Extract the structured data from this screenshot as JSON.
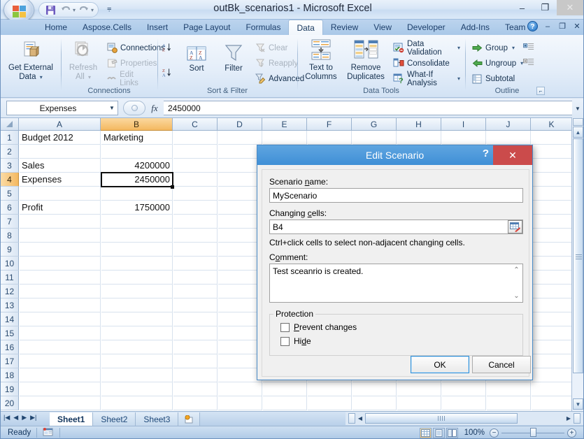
{
  "window": {
    "title": "outBk_scenarios1 - Microsoft Excel",
    "minimize": "–",
    "maximize": "❐",
    "close": "✕"
  },
  "quick_access": {
    "save_icon": "save-icon",
    "undo_icon": "undo-icon",
    "redo_icon": "redo-icon",
    "customize_icon": "customize-qat-icon"
  },
  "ribbon": {
    "tabs": [
      {
        "label": "Home",
        "active": false
      },
      {
        "label": "Aspose.Cells",
        "active": false
      },
      {
        "label": "Insert",
        "active": false
      },
      {
        "label": "Page Layout",
        "active": false
      },
      {
        "label": "Formulas",
        "active": false
      },
      {
        "label": "Data",
        "active": true
      },
      {
        "label": "Review",
        "active": false
      },
      {
        "label": "View",
        "active": false
      },
      {
        "label": "Developer",
        "active": false
      },
      {
        "label": "Add-Ins",
        "active": false
      },
      {
        "label": "Team",
        "active": false
      }
    ],
    "help_icon": "help-icon",
    "ribbon_minimize": "–",
    "ribbon_restore": "❐",
    "ribbon_close": "✕",
    "groups": [
      {
        "name": "Get External Data",
        "label": "",
        "items": [
          {
            "label": "Get External\nData",
            "line1": "Get External",
            "line2": "Data",
            "dropdown": true,
            "disabled": false
          }
        ]
      },
      {
        "name": "Connections",
        "label": "Connections",
        "items": [
          {
            "label": "Refresh",
            "line1": "Refresh",
            "line2": "All",
            "dropdown": true,
            "disabled": true
          },
          {
            "label": "Connections",
            "disabled": false
          },
          {
            "label": "Properties",
            "disabled": true
          },
          {
            "label": "Edit Links",
            "disabled": true
          }
        ]
      },
      {
        "name": "Sort & Filter",
        "label": "Sort & Filter",
        "items": [
          {
            "label": "Sort A to Z",
            "disabled": false
          },
          {
            "label": "Sort Z to A",
            "disabled": false
          },
          {
            "label": "Sort",
            "disabled": false
          },
          {
            "label": "Filter",
            "disabled": false
          },
          {
            "label": "Clear",
            "disabled": true
          },
          {
            "label": "Reapply",
            "disabled": true
          },
          {
            "label": "Advanced",
            "disabled": false
          }
        ]
      },
      {
        "name": "Data Tools",
        "label": "Data Tools",
        "items": [
          {
            "label": "Text to",
            "line1": "Text to",
            "line2": "Columns",
            "disabled": false
          },
          {
            "label": "Remove",
            "line1": "Remove",
            "line2": "Duplicates",
            "disabled": false
          },
          {
            "label": "Data Validation",
            "dropdown": true,
            "disabled": false
          },
          {
            "label": "Consolidate",
            "disabled": false
          },
          {
            "label": "What-If Analysis",
            "dropdown": true,
            "disabled": false
          }
        ]
      },
      {
        "name": "Outline",
        "label": "Outline",
        "items": [
          {
            "label": "Group",
            "dropdown": true,
            "disabled": false
          },
          {
            "label": "Ungroup",
            "dropdown": true,
            "disabled": false
          },
          {
            "label": "Subtotal",
            "disabled": false
          },
          {
            "label": "Show Detail",
            "disabled": false
          },
          {
            "label": "Hide Detail",
            "disabled": false
          }
        ]
      }
    ]
  },
  "formula_bar": {
    "name_box_value": "Expenses",
    "name_box_dropdown": "▼",
    "fx_label": "fx",
    "formula_value": "2450000",
    "expand_icon": "▼"
  },
  "grid": {
    "columns": [
      "A",
      "B",
      "C",
      "D",
      "E",
      "F",
      "G",
      "H",
      "I",
      "J",
      "K"
    ],
    "selected_column": "B",
    "rows": [
      "1",
      "2",
      "3",
      "4",
      "5",
      "6",
      "7",
      "8",
      "9",
      "10",
      "11",
      "12",
      "13",
      "14",
      "15",
      "16",
      "17",
      "18",
      "19",
      "20"
    ],
    "selected_row": "4",
    "cells": [
      {
        "row": 1,
        "col": "A",
        "value": "Budget 2012",
        "align": "left"
      },
      {
        "row": 1,
        "col": "B",
        "value": "Marketing",
        "align": "left"
      },
      {
        "row": 3,
        "col": "A",
        "value": "Sales",
        "align": "left"
      },
      {
        "row": 3,
        "col": "B",
        "value": "4200000",
        "align": "right"
      },
      {
        "row": 4,
        "col": "A",
        "value": "Expenses",
        "align": "left"
      },
      {
        "row": 4,
        "col": "B",
        "value": "2450000",
        "align": "right"
      },
      {
        "row": 6,
        "col": "A",
        "value": "Profit",
        "align": "left"
      },
      {
        "row": 6,
        "col": "B",
        "value": "1750000",
        "align": "right"
      }
    ],
    "active_cell": "B4"
  },
  "sheet_tabs": {
    "first_icon": "first-sheet-icon",
    "prev_icon": "prev-sheet-icon",
    "next_icon": "next-sheet-icon",
    "last_icon": "last-sheet-icon",
    "tabs": [
      {
        "label": "Sheet1",
        "active": true
      },
      {
        "label": "Sheet2",
        "active": false
      },
      {
        "label": "Sheet3",
        "active": false
      }
    ],
    "insert_sheet_icon": "insert-worksheet-icon"
  },
  "status_bar": {
    "status": "Ready",
    "macro_icon": "record-macro-icon",
    "views": [
      "normal-view-icon",
      "page-layout-view-icon",
      "page-break-view-icon"
    ],
    "active_view": "normal-view-icon",
    "zoom": "100%",
    "zoom_out": "−",
    "zoom_in": "+"
  },
  "dialog": {
    "title": "Edit Scenario",
    "help_btn": "?",
    "close_btn": "✕",
    "scenario_name_label": "Scenario name:",
    "scenario_name_label_pre": "Scenario ",
    "scenario_name_label_key": "n",
    "scenario_name_label_post": "ame:",
    "scenario_name_value": "MyScenario",
    "changing_cells_label_pre": "Changing ",
    "changing_cells_label_key": "c",
    "changing_cells_label_post": "ells:",
    "changing_cells_value": "B4",
    "range_picker_icon": "range-selector-icon",
    "hint": "Ctrl+click cells to select non-adjacent changing cells.",
    "comment_label_pre": "C",
    "comment_label_key": "o",
    "comment_label_post": "mment:",
    "comment_value": "Test sceanrio is created.",
    "scroll_up_icon": "⌃",
    "scroll_down_icon": "⌄",
    "protection_label": "Protection",
    "prevent_changes_pre": "",
    "prevent_changes_key": "P",
    "prevent_changes_post": "revent changes",
    "prevent_changes_checked": false,
    "hide_pre": "Hi",
    "hide_key": "d",
    "hide_post": "e",
    "hide_checked": false,
    "ok_label": "OK",
    "cancel_label": "Cancel"
  },
  "colors": {
    "accent": "#3f8fd6",
    "selected_header": "#f4b860",
    "close_red": "#cb4b4b",
    "dialog_titlebar": "#4a97da"
  }
}
